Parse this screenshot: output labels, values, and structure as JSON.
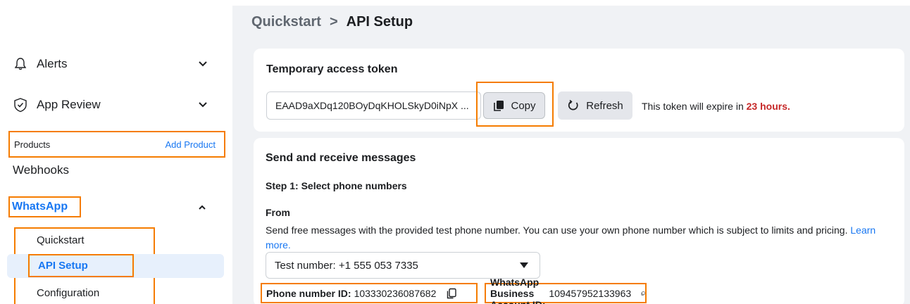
{
  "breadcrumb": {
    "parent": "Quickstart",
    "separator": ">",
    "current": "API Setup"
  },
  "sidebar": {
    "alerts": "Alerts",
    "app_review": "App Review",
    "products_label": "Products",
    "add_product": "Add Product",
    "webhooks": "Webhooks",
    "whatsapp": "WhatsApp",
    "sub_items": [
      "Quickstart",
      "API Setup",
      "Configuration"
    ]
  },
  "token_card": {
    "title": "Temporary access token",
    "token_value": "EAAD9aXDq120BOyDqKHOLSkyD0iNpX ...",
    "copy_label": "Copy",
    "refresh_label": "Refresh",
    "expire_prefix": "This token will expire in ",
    "expire_hours": "23 hours."
  },
  "messages_card": {
    "title": "Send and receive messages",
    "step1": "Step 1: Select phone numbers",
    "from_label": "From",
    "description": "Send free messages with the provided test phone number. You can use your own phone number which is subject to limits and pricing. ",
    "learn_more": "Learn more.",
    "selected_number": "Test number: +1 555 053 7335",
    "phone_id_label": "Phone number ID:",
    "phone_id_value": "103330236087682",
    "waba_id_label": "WhatsApp Business Account ID:",
    "waba_id_value": "109457952133963"
  },
  "colors": {
    "highlight": "#f57c00",
    "link": "#1877f2",
    "expire": "#c62828"
  }
}
